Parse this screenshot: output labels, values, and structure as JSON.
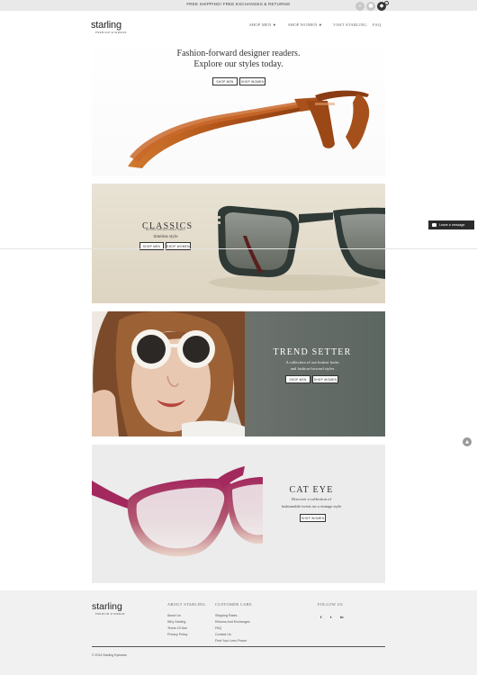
{
  "topbar": {
    "promo": "FREE SHIPPING! FREE EXCHANGES & RETURNS!",
    "icons": [
      "search-icon",
      "user-icon",
      "cart-icon"
    ],
    "cart_count": "0"
  },
  "header": {
    "logo": "starling",
    "logo_sub": "PREMIUM EYEWEAR",
    "nav": [
      {
        "label": "SHOP MEN",
        "has_caret": true
      },
      {
        "label": "SHOP WOMEN",
        "has_caret": true
      },
      {
        "label": "VISIT STARLING"
      },
      {
        "label": "FAQ"
      }
    ]
  },
  "hero": {
    "line1": "Fashion-forward designer readers.",
    "line2": "Explore our styles today.",
    "btn_men": "SHOP MEN",
    "btn_women": "SHOP WOMEN"
  },
  "classics": {
    "title": "CLASSICS",
    "subtitle": "ROUND REIMAGINED WELL",
    "tagline": "timeless style",
    "btn_men": "SHOP MEN",
    "btn_women": "SHOP WOMEN"
  },
  "trend": {
    "title": "TREND SETTER",
    "desc1": "A collection of our hottest looks",
    "desc2": "and fashion forward styles",
    "btn_men": "SHOP MEN",
    "btn_women": "SHOP WOMEN"
  },
  "cateye": {
    "title": "CAT EYE",
    "desc1": "Discover a collection of",
    "desc2": "fashionable twists on a vintage style",
    "btn_women": "SHOP WOMEN"
  },
  "widget": {
    "label": "Leave a message"
  },
  "footer": {
    "logo": "starling",
    "logo_sub": "PREMIUM EYEWEAR",
    "about_title": "ABOUT STARLING",
    "about_links": [
      "About Us",
      "Why Starling",
      "Terms Of Use",
      "Privacy Policy"
    ],
    "care_title": "CUSTOMER CARE",
    "care_links": [
      "Shipping Rates",
      "Returns And Exchanges",
      "FAQ",
      "Contact Us",
      "Find Your Lens Power"
    ],
    "follow_title": "FOLLOW US",
    "social": [
      "f",
      "t",
      "in"
    ],
    "copyright": "© 2014 Starling Eyewear"
  },
  "colors": {
    "accent_dark": "#333333",
    "classics_bg": "#e4ddcc",
    "trend_bg": "#6f7570",
    "cateye_bg": "#ececec",
    "footer_bg": "#f1f1f1"
  }
}
